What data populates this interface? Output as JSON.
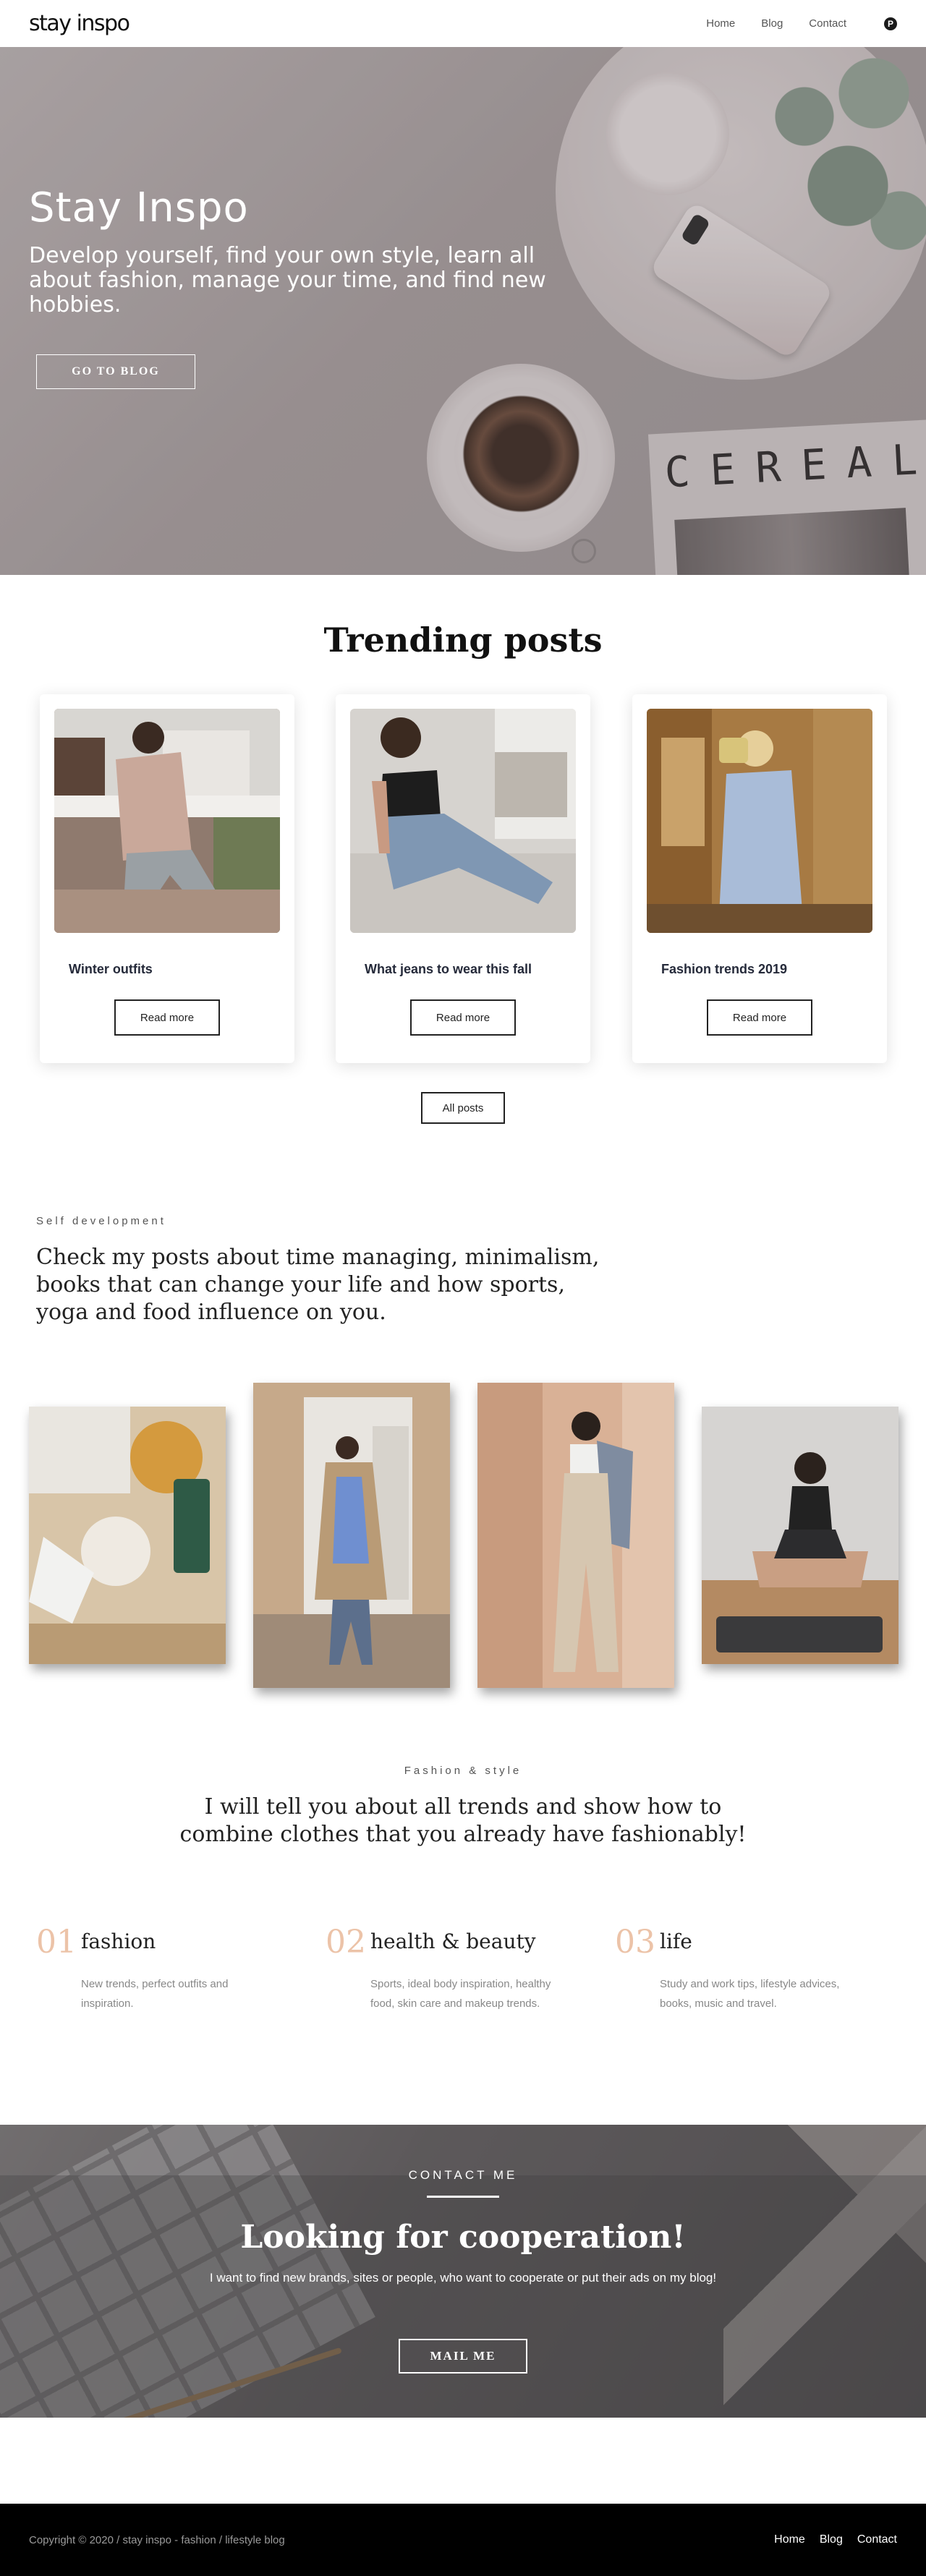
{
  "nav": {
    "logo": "stay inspo",
    "links": [
      "Home",
      "Blog",
      "Contact"
    ],
    "social_icon": "pinterest-icon",
    "social_glyph": "P"
  },
  "hero": {
    "title": "Stay Inspo",
    "subtitle": "Develop yourself, find your own style, learn all about fashion, manage your time, and find new hobbies.",
    "button": "GO TO BLOG",
    "magazine_text": "CEREAL"
  },
  "trending": {
    "title": "Trending posts",
    "cards": [
      {
        "title": "Winter outfits",
        "button": "Read more"
      },
      {
        "title": "What jeans to wear this fall",
        "button": "Read more"
      },
      {
        "title": "Fashion trends 2019",
        "button": "Read more"
      }
    ],
    "all_posts": "All posts"
  },
  "self_dev": {
    "label": "Self development",
    "text": "Check my posts about time managing, minimalism, books that can change your life and how sports, yoga and food influence on you."
  },
  "fashion_style": {
    "label": "Fashion & style",
    "text": "I will tell you about all trends and show how to combine clothes that you already have fashionably!",
    "categories": [
      {
        "num": "01",
        "name": "fashion",
        "desc": "New trends, perfect outfits and inspiration."
      },
      {
        "num": "02",
        "name": "health & beauty",
        "desc": "Sports, ideal body inspiration, healthy food, skin care and makeup trends."
      },
      {
        "num": "03",
        "name": "life",
        "desc": "Study and work tips, lifestyle advices, books, music and travel."
      }
    ]
  },
  "contact": {
    "label": "CONTACT ME",
    "title": "Looking for cooperation!",
    "subtitle": "I want to find new brands, sites or people, who want to cooperate or put their ads on my blog!",
    "button": "MAIL ME"
  },
  "footer": {
    "copyright": "Copyright © 2020 / stay inspo - fashion / lifestyle blog",
    "links": [
      "Home",
      "Blog",
      "Contact"
    ]
  },
  "colors": {
    "accent_number": "#ecc3a8",
    "footer_bg": "#000000",
    "text_dark": "#222222"
  }
}
